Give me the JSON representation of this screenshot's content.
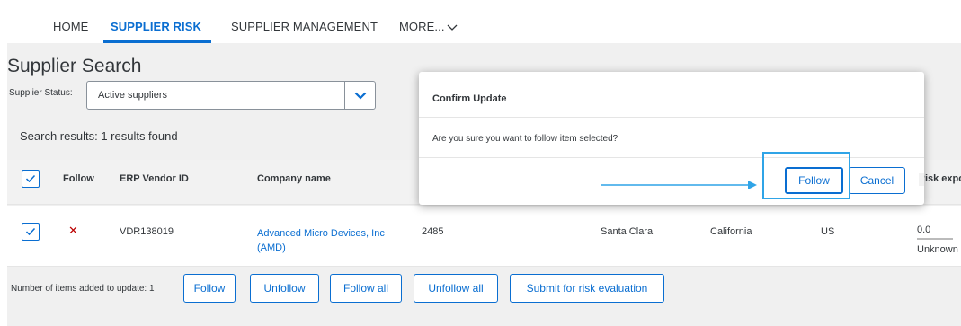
{
  "nav": {
    "tabs": [
      "HOME",
      "SUPPLIER RISK",
      "SUPPLIER MANAGEMENT",
      "MORE..."
    ],
    "active": "SUPPLIER RISK"
  },
  "page": {
    "title": "Supplier Search",
    "status_label": "Supplier Status:",
    "status_value": "Active suppliers",
    "results_text": "Search results: 1 results found"
  },
  "table": {
    "headers": {
      "follow": "Follow",
      "erp": "ERP Vendor ID",
      "company": "Company name",
      "risk": "Risk exposure"
    },
    "row": {
      "erp": "VDR138019",
      "company": "Advanced Micro Devices, Inc (AMD)",
      "id": "2485",
      "city": "Santa Clara",
      "state": "California",
      "country": "US",
      "risk_value": "0.0",
      "risk_label": "Unknown"
    }
  },
  "footer": {
    "label": "Number of items added to update: 1",
    "buttons": [
      "Follow",
      "Unfollow",
      "Follow all",
      "Unfollow all",
      "Submit for risk evaluation"
    ]
  },
  "dialog": {
    "title": "Confirm Update",
    "message": "Are you sure you want to follow item selected?",
    "confirm": "Follow",
    "cancel": "Cancel"
  },
  "colors": {
    "accent": "#0a6ed1",
    "highlight": "#2fa4e7",
    "danger": "#bb0000"
  }
}
